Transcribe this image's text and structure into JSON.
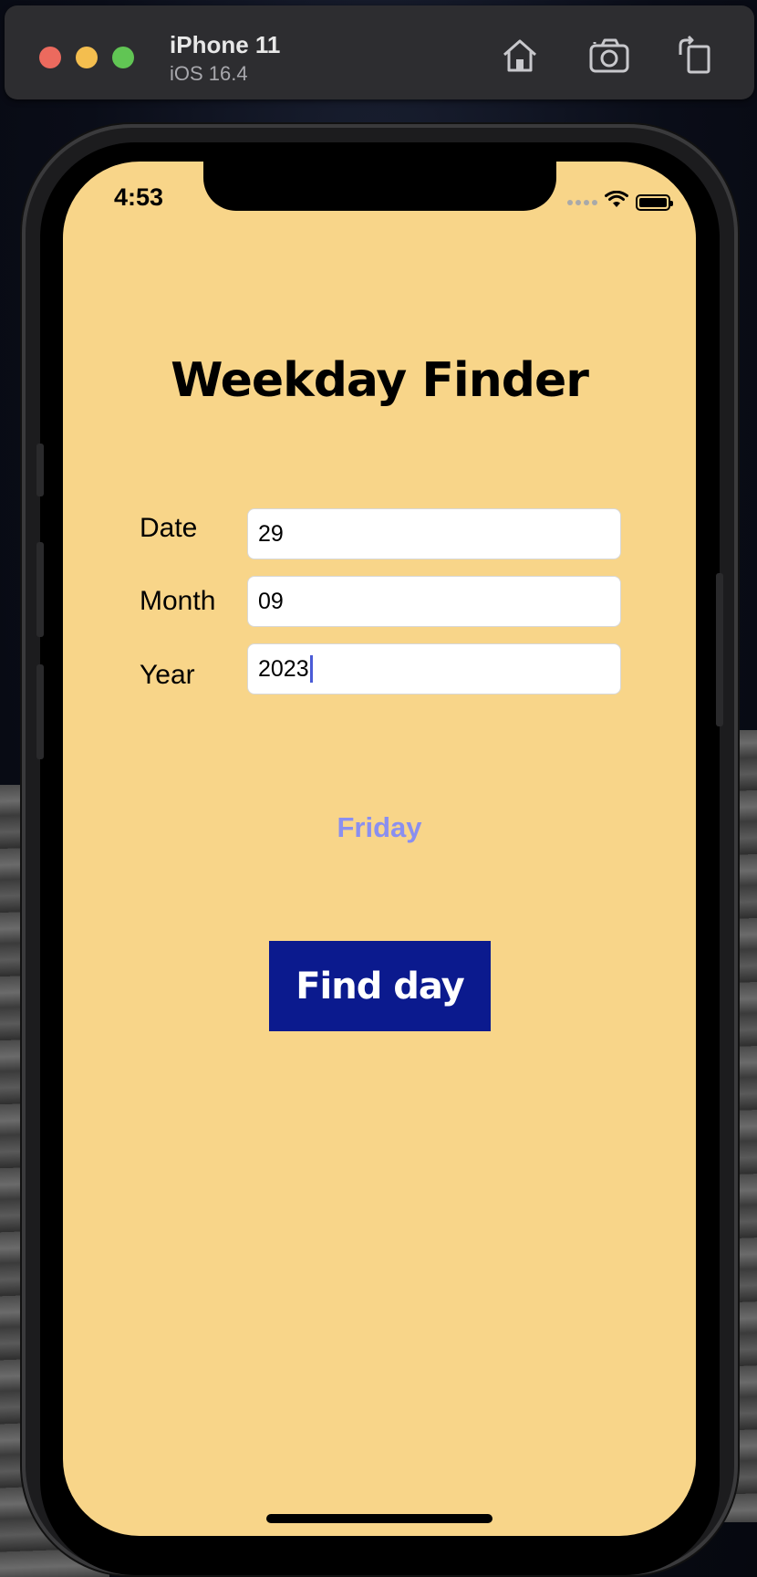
{
  "simulator": {
    "device_name": "iPhone 11",
    "os_version": "iOS 16.4",
    "icons": [
      "home-icon",
      "screenshot-icon",
      "rotate-icon"
    ]
  },
  "status_bar": {
    "time": "4:53",
    "icons": [
      "cellular-dots-icon",
      "wifi-icon",
      "battery-icon"
    ]
  },
  "app": {
    "title": "Weekday Finder",
    "fields": {
      "date": {
        "label": "Date",
        "value": "29"
      },
      "month": {
        "label": "Month",
        "value": "09"
      },
      "year": {
        "label": "Year",
        "value": "2023"
      }
    },
    "result": "Friday",
    "button_label": "Find day"
  },
  "colors": {
    "screen_background": "#f8d589",
    "button_background": "#0b1a8e",
    "result_text": "#8a8ff0",
    "caret": "#4a5bd6"
  }
}
